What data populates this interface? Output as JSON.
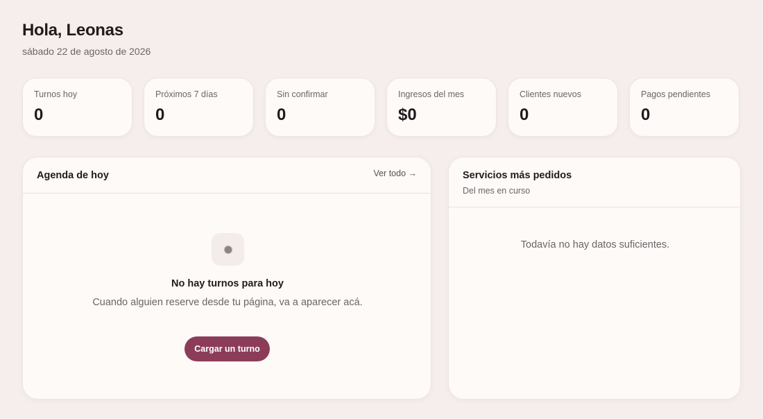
{
  "header": {
    "greeting": "Hola, Leonas",
    "date": "sábado 22 de agosto de 2026"
  },
  "stats": [
    {
      "label": "Turnos hoy",
      "value": "0"
    },
    {
      "label": "Próximos 7 días",
      "value": "0"
    },
    {
      "label": "Sin confirmar",
      "value": "0"
    },
    {
      "label": "Ingresos del mes",
      "value": "$0"
    },
    {
      "label": "Clientes nuevos",
      "value": "0"
    },
    {
      "label": "Pagos pendientes",
      "value": "0"
    }
  ],
  "agenda": {
    "title": "Agenda de hoy",
    "see_all": "Ver todo →",
    "empty_title": "No hay turnos para hoy",
    "empty_desc": "Cuando alguien reserve desde tu página, va a aparecer acá.",
    "cta_label": "Cargar un turno",
    "empty_icon": "dot-icon"
  },
  "services": {
    "title": "Servicios más pedidos",
    "subtitle": "Del mes en curso",
    "empty_text": "Todavía no hay datos suficientes."
  },
  "colors": {
    "background": "#f5eeec",
    "card": "#fdfaf8",
    "accent": "#8c3c59"
  }
}
